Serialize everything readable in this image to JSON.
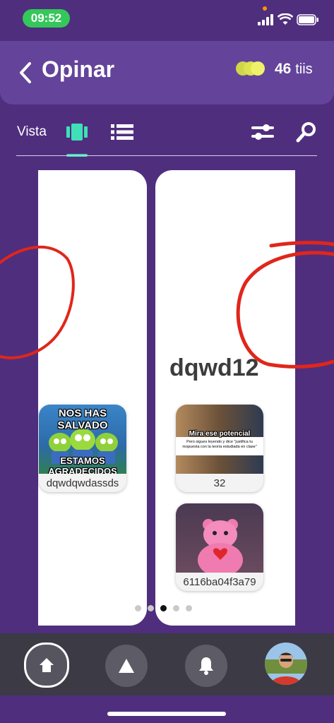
{
  "status_bar": {
    "time": "09:52"
  },
  "header": {
    "back_icon": "chevron-left-icon",
    "title": "Opinar",
    "coin_count": "46",
    "coin_unit": "tiis"
  },
  "toolbar": {
    "vista_label": "Vista",
    "active_view": "card-view"
  },
  "cards": {
    "left": {
      "items": [
        {
          "caption": "dqwdqwdassds",
          "meme_top": "NOS HAS SALVADO",
          "meme_bottom": "ESTAMOS AGRADECIDOS"
        }
      ]
    },
    "right": {
      "title": "dqwd12",
      "items": [
        {
          "caption": "32",
          "meme_top": "Mira ese potencial",
          "meme_body": "Pero sigues leyendo y dice \"justifica tu respuesta con la teoría estudiada en clase\""
        },
        {
          "caption": "6116ba04f3a79"
        }
      ]
    }
  },
  "pagination": {
    "count": 5,
    "active_index": 2
  },
  "colors": {
    "background": "#4f2e7e",
    "header": "#63449a",
    "accent": "#3fe0b8",
    "annotation": "#e0261b"
  }
}
